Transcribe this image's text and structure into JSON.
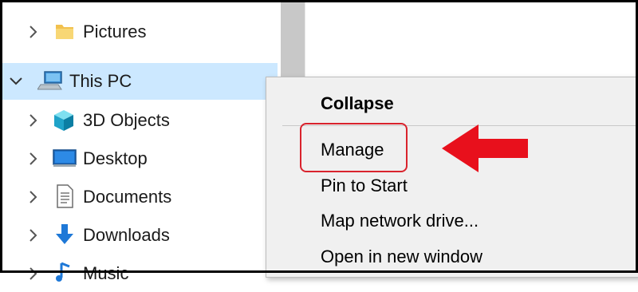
{
  "nav_pane": {
    "items": [
      {
        "label": "Pictures",
        "icon": "folder-icon",
        "chevron": "chevron-right"
      },
      {
        "label": "This PC",
        "icon": "computer-icon",
        "chevron": "chevron-down",
        "selected": true
      },
      {
        "label": "3D Objects",
        "icon": "3d-objects-icon",
        "chevron": "chevron-right"
      },
      {
        "label": "Desktop",
        "icon": "desktop-icon",
        "chevron": "chevron-right"
      },
      {
        "label": "Documents",
        "icon": "documents-icon",
        "chevron": "chevron-right"
      },
      {
        "label": "Downloads",
        "icon": "downloads-icon",
        "chevron": "chevron-right"
      },
      {
        "label": "Music",
        "icon": "music-icon",
        "chevron": "chevron-right"
      }
    ]
  },
  "context_menu": {
    "items": [
      {
        "label": "Collapse",
        "bold": true
      },
      {
        "label": "Manage",
        "highlighted": true
      },
      {
        "label": "Pin to Start"
      },
      {
        "label": "Map network drive..."
      },
      {
        "label": "Open in new window"
      }
    ]
  },
  "annotation": {
    "highlight_color": "#d9232d",
    "arrow_color": "#e8101c",
    "arrow_direction": "left"
  },
  "colors": {
    "selection": "#cce8ff",
    "menu_background": "#f0f0f0"
  }
}
